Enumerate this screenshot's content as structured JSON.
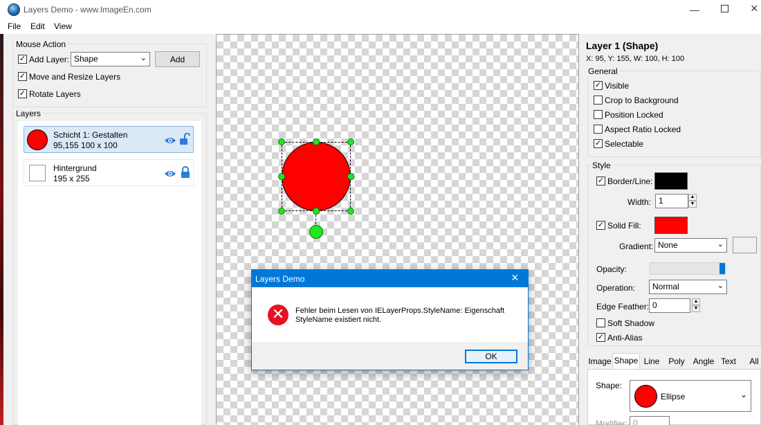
{
  "window": {
    "title": "Layers Demo - www.ImageEn.com"
  },
  "menu": [
    "File",
    "Edit",
    "View"
  ],
  "mouse_action": {
    "legend": "Mouse Action",
    "add_layer_label": "Add Layer:",
    "add_layer_type": "Shape",
    "add_button": "Add",
    "move_resize_label": "Move and Resize Layers",
    "rotate_label": "Rotate Layers"
  },
  "layers_panel": {
    "legend": "Layers",
    "items": [
      {
        "name": "Schicht 1: Gestalten",
        "info": "95,155  100 x 100",
        "selected": true,
        "thumb_color": "#ff0000"
      },
      {
        "name": "Hintergrund",
        "info": "195 x 255",
        "selected": false,
        "thumb_color": "#ffffff"
      }
    ]
  },
  "props": {
    "title": "Layer 1 (Shape)",
    "coords": "X: 95, Y: 155, W: 100, H: 100",
    "general": {
      "legend": "General",
      "visible": "Visible",
      "crop": "Crop to Background",
      "pos_locked": "Position Locked",
      "aspect_locked": "Aspect Ratio Locked",
      "selectable": "Selectable"
    },
    "style": {
      "legend": "Style",
      "border_label": "Border/Line:",
      "border_color": "#000000",
      "width_label": "Width:",
      "width_value": "1",
      "solid_fill_label": "Solid Fill:",
      "fill_color": "#ff0000",
      "gradient_label": "Gradient:",
      "gradient_value": "None",
      "opacity_label": "Opacity:",
      "opacity_value": 1.0,
      "operation_label": "Operation:",
      "operation_value": "Normal",
      "edge_feather_label": "Edge Feather:",
      "edge_feather_value": "0",
      "soft_shadow": "Soft Shadow",
      "anti_alias": "Anti-Alias"
    },
    "tabs": [
      "Image",
      "Shape",
      "Line",
      "Poly",
      "Angle",
      "Text",
      "All"
    ],
    "active_tab": "Shape",
    "shape_label": "Shape:",
    "shape_value": "Ellipse",
    "modifier_label": "Modifier:",
    "modifier_value": "0"
  },
  "dialog": {
    "title": "Layers Demo",
    "message_line1": "Fehler beim Lesen von IELayerProps.StyleName: Eigenschaft",
    "message_line2": "StyleName existiert nicht.",
    "ok": "OK"
  },
  "colors": {
    "accent": "#0078d7",
    "shape": "#ff0000",
    "handle": "#21e621",
    "error": "#e81123"
  }
}
